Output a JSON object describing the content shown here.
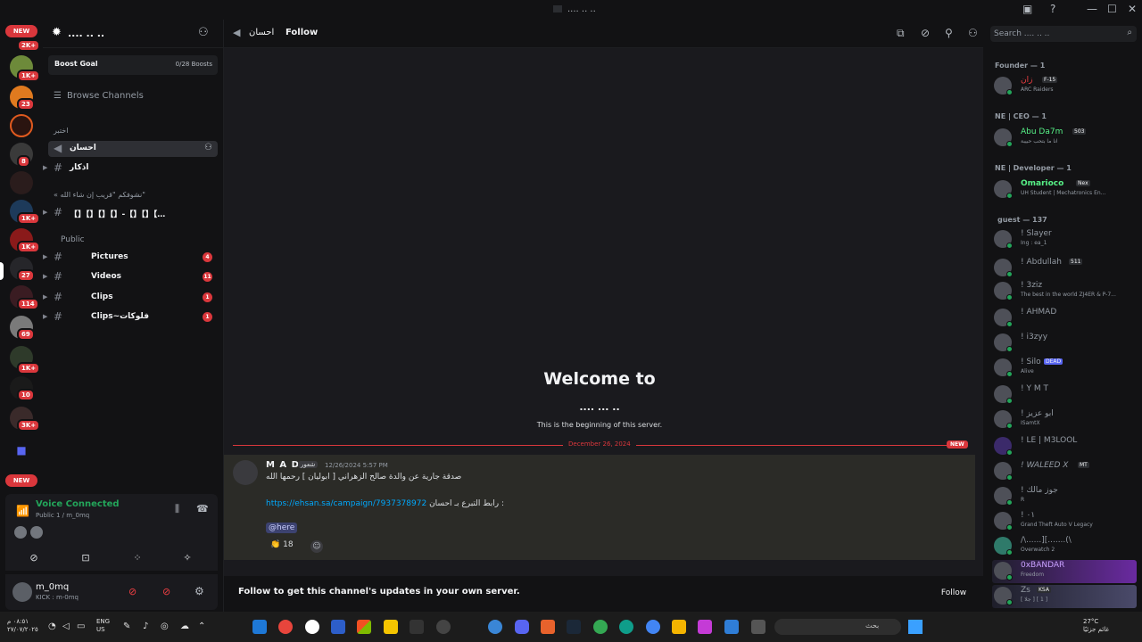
{
  "window": {
    "title": ".... .. .."
  },
  "server": {
    "name": ".... .. ..",
    "boost_label": "Boost Goal",
    "boost_count": "0/28 Boosts",
    "browse_label": "Browse Channels"
  },
  "rail": {
    "top_new": "NEW",
    "bottom_new": "NEW",
    "badges": [
      "2K+",
      "1K+",
      "23",
      "8",
      "1K+",
      "1K+",
      "27",
      "114",
      "69",
      "1K+",
      "10",
      "3K+"
    ]
  },
  "channels": {
    "cat1": "اختبر",
    "cat2": "« نشوفكم \"قريب إن شاء الله\"",
    "cat3": "Public",
    "voice_channel": "احسان",
    "ch_athkar": "اذكار",
    "ch_symbols": "【】【】【】【】-【】【】【…",
    "ch_pictures": "Pictures",
    "ch_videos": "Videos",
    "ch_clips": "Clips",
    "ch_clips2": "Clips~فلوكات",
    "cnt_pictures": "4",
    "cnt_videos": "11",
    "cnt_clips": "1",
    "cnt_clips2": "1"
  },
  "voice": {
    "status": "Voice Connected",
    "sub": "Public 1 / m_0mq"
  },
  "user": {
    "name": "m_0mq",
    "status": "KICK : m-0mq"
  },
  "header": {
    "channel": "احسان",
    "follow": "Follow"
  },
  "welcome": {
    "title": "Welcome to",
    "server_name": ".... ... ..",
    "subtitle": "This is the beginning of this server."
  },
  "divider": {
    "date": "December 26, 2024",
    "new": "NEW"
  },
  "message": {
    "author": "M A D",
    "tag": "شعور",
    "timestamp": "12/26/2024 5:57 PM",
    "text1": "صدقة جارية عن والدة صالح الزهراني [ ابوليان ] رحمها الله",
    "link": "https://ehsan.sa/campaign/7937378972",
    "text2": "رابط التبرع بـ احسان :",
    "mention": "@here",
    "reaction_count": "18"
  },
  "follow_bar": {
    "text": "Follow to get this channel's updates in your own server.",
    "button": "Follow"
  },
  "search": {
    "placeholder": "Search .... .. .."
  },
  "members": {
    "groups": [
      "Founder — 1",
      "NE | CEO — 1",
      "NE | Developer — 1",
      "guest — 137"
    ],
    "list": [
      {
        "name": "ﺯﺍﻥ",
        "tag": "F-15",
        "sub": "ARC Raiders"
      },
      {
        "name": "Abu Da7m",
        "tag": "503",
        "sub": "انا ما بتحب حبيبة"
      },
      {
        "name": "Omarioco",
        "tag": "Nex",
        "sub": "UH Student | Mechatronics En..."
      },
      {
        "name": "! Slayer",
        "tag": "",
        "sub": "Ing : ea_1"
      },
      {
        "name": "! Abdullah",
        "tag": "511",
        "sub": ""
      },
      {
        "name": "! 3ziz",
        "tag": "",
        "sub": "The best in the world ZJ4ER & P-7..."
      },
      {
        "name": "! AHMAD",
        "tag": "",
        "sub": ""
      },
      {
        "name": "! i3zyy",
        "tag": "",
        "sub": ""
      },
      {
        "name": "! Silo",
        "tag": "DEAD",
        "sub": "Alive"
      },
      {
        "name": "! Y M T",
        "tag": "",
        "sub": ""
      },
      {
        "name": "! ﺍﺑﻮ ﻋﺰﻳﺰ",
        "tag": "",
        "sub": "ISamtX"
      },
      {
        "name": "! LE | M3LOOL",
        "tag": "",
        "sub": ""
      },
      {
        "name": "! WALEED X",
        "tag": "MT",
        "sub": ""
      },
      {
        "name": "! ﺟﻮﺯ ﻣﺎﻟﻚ",
        "tag": "",
        "sub": "R"
      },
      {
        "name": "! ٠١",
        "tag": "",
        "sub": "Grand Theft Auto V Legacy"
      },
      {
        "name": "/\\......][.......(\\",
        "tag": "",
        "sub": "Overwatch 2"
      },
      {
        "name": "0xBANDAR",
        "tag": "",
        "sub": "Freedom"
      },
      {
        "name": "Zs",
        "tag": "KSA",
        "sub": "[ جلا ] [ 1 ]"
      }
    ]
  },
  "taskbar": {
    "time": "٠٨:٥١ م",
    "date": "٢٧/٠٧/٢٠٢٥",
    "lang": "ENG",
    "lang2": "US",
    "search": "بحث",
    "temp": "27°C",
    "weather": "غائم جزئيًا"
  },
  "colors": {
    "accent": "#5865f2",
    "online": "#23a55a",
    "danger": "#da373c",
    "link": "#00a8fc"
  }
}
